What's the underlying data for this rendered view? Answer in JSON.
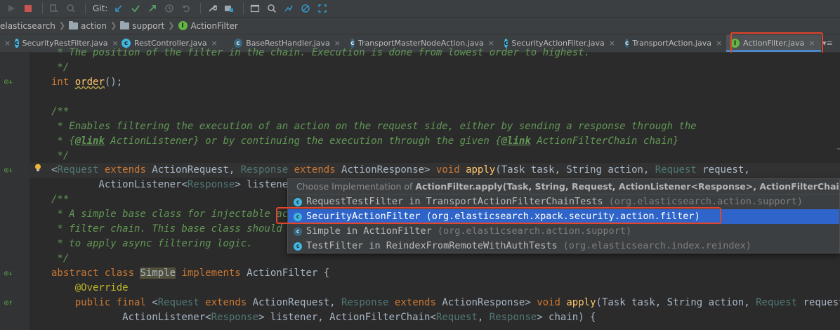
{
  "toolbar": {
    "git_label": "Git:"
  },
  "breadcrumb": [
    "elasticsearch",
    "action",
    "support",
    "ActionFilter"
  ],
  "tabs": [
    {
      "label": "SecurityRestFilter.java",
      "icon": "class"
    },
    {
      "label": "RestController.java",
      "icon": "class"
    },
    {
      "label": "BaseRestHandler.java",
      "icon": "abstract-class"
    },
    {
      "label": "TransportMasterNodeAction.java",
      "icon": "abstract-class"
    },
    {
      "label": "SecurityActionFilter.java",
      "icon": "class"
    },
    {
      "label": "TransportAction.java",
      "icon": "abstract-class"
    },
    {
      "label": "ActionFilter.java",
      "icon": "interface",
      "active": true
    }
  ],
  "code": {
    "l1": " * The position of the filter in the chain. Execution is done from lowest order to highest.",
    "l2": " */",
    "l3_kw": "int",
    "l3_fn": "order",
    "l3_rest": "();",
    "l5": "/**",
    "l6": " * Enables filtering the execution of an action on the request side, either by sending a response through the",
    "l7_a": " * {",
    "l7_tag1": "@link",
    "l7_b": " ActionListener} or by continuing the execution through the given {",
    "l7_tag2": "@link",
    "l7_c": " ActionFilterChain chain}",
    "l8": " */",
    "l9_lt": "<",
    "l9_t1": "Request",
    "l9_kw1": " extends ",
    "l9_c1": "ActionRequest, ",
    "l9_t2": "Response",
    "l9_kw2": " extends ",
    "l9_c2": "ActionResponse> ",
    "l9_kw3": "void ",
    "l9_fn": "apply",
    "l9_p1": "(Task task, String action, ",
    "l9_t3": "Request",
    "l9_p2": " request,",
    "l10_a": "        ActionListener<",
    "l10_t": "Response",
    "l10_b": "> listener, ",
    "l11": "/**",
    "l12": " * A simple base class for injectable acti",
    "l13": " * filter chain. This base class should se",
    "l14": " * to apply async filtering logic.",
    "l15": " */",
    "l16_kw1": "abstract class ",
    "l16_cls": "Simple",
    "l16_kw2": " implements ",
    "l16_rest": "ActionFilter {",
    "l17": "    @Override",
    "l18_kw": "    public final ",
    "l18_lt": "<",
    "l18_t1": "Request",
    "l18_kw1": " extends ",
    "l18_c1": "ActionRequest, ",
    "l18_t2": "Response",
    "l18_kw2": " extends ",
    "l18_c2": "ActionResponse> ",
    "l18_kw3": "void ",
    "l18_fn": "apply",
    "l18_p1": "(Task task, String action, ",
    "l18_t3": "Request",
    "l18_p2": " request,",
    "l19_a": "            ActionListener<",
    "l19_t1": "Response",
    "l19_b": "> listener, ActionFilterChain<",
    "l19_t2": "Request",
    "l19_c": ", ",
    "l19_t3": "Response",
    "l19_d": "> chain) {"
  },
  "popup": {
    "header_prefix": "Choose Implementation of ",
    "header_bold": "ActionFilter.apply(Task, String, Request, ActionListener<Response>, ActionFilterChain<Req",
    "items": [
      {
        "name": "RequestTestFilter in TransportActionFilterChainTests",
        "pkg": "(org.elasticsearch.action.support)"
      },
      {
        "name": "SecurityActionFilter",
        "pkg": "(org.elasticsearch.xpack.security.action.filter)",
        "selected": true
      },
      {
        "name": "Simple in ActionFilter",
        "pkg": "(org.elasticsearch.action.support)"
      },
      {
        "name": "TestFilter in ReindexFromRemoteWithAuthTests",
        "pkg": "(org.elasticsearch.index.reindex)"
      }
    ]
  },
  "colors": {
    "highlight_box": "#e2452c",
    "selection": "#2f65ca",
    "keyword": "#cc7832",
    "comment": "#629755"
  }
}
